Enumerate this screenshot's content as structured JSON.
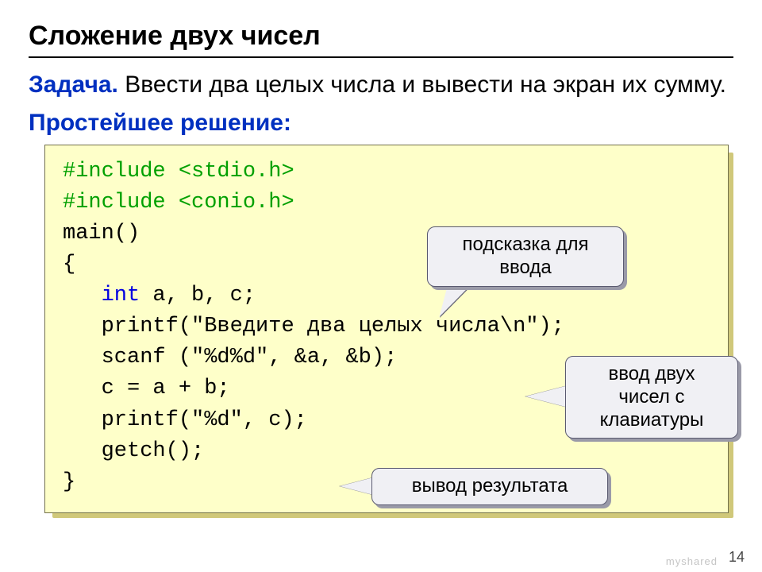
{
  "title": "Сложение двух чисел",
  "task": {
    "label": "Задача.",
    "text": " Ввести два целых числа и вывести на экран их сумму."
  },
  "subhead": "Простейшее решение:",
  "code": {
    "l1_a": "#include ",
    "l1_b": "<stdio.h>",
    "l2_a": "#include ",
    "l2_b": "<conio.h>",
    "l3": "main()",
    "l4": "{",
    "l5_a": "   ",
    "l5_b": "int",
    "l5_c": " a, b, c;",
    "l6": "   printf(\"Введите два целых числа\\n\");",
    "l7": "   scanf (\"%d%d\", &a, &b);",
    "l8": "   c = a + b;",
    "l9": "   printf(\"%d\", c);",
    "l10": "   getch();",
    "l11": "}"
  },
  "callouts": {
    "c1": "подсказка для ввода",
    "c2": "ввод двух чисел с клавиатуры",
    "c3": "вывод результата"
  },
  "pagenum": "14",
  "watermark": "myshared"
}
